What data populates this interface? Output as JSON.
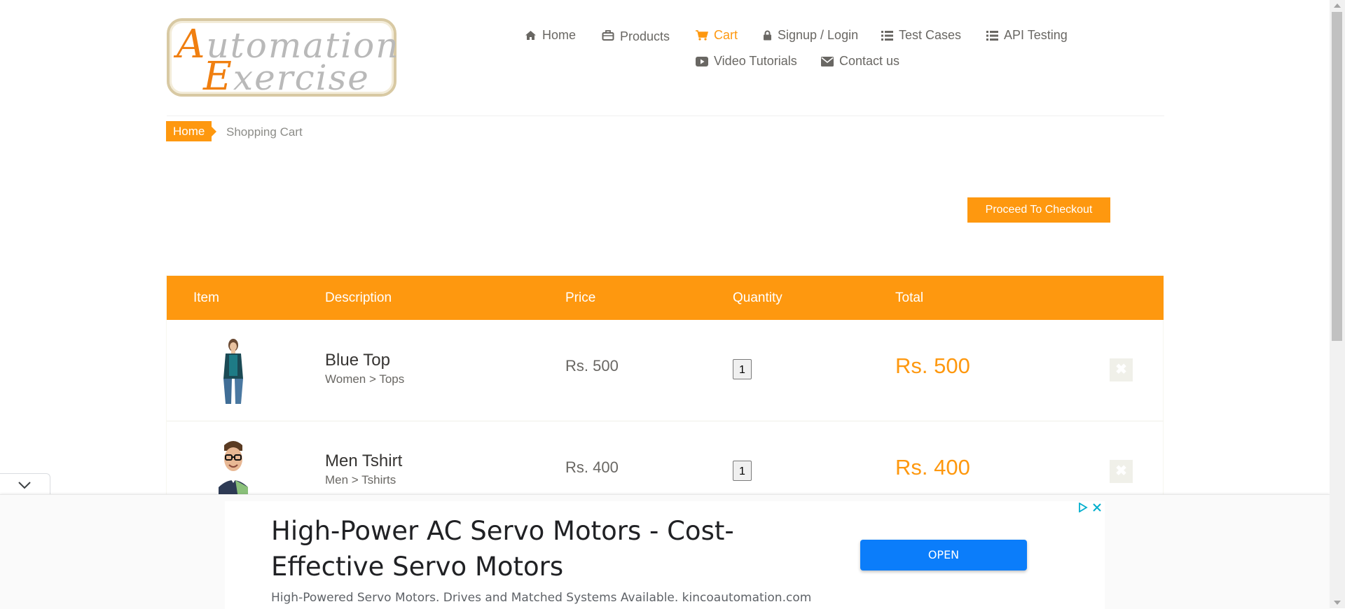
{
  "logo": {
    "line1_cap": "A",
    "line1_rest": "utomation",
    "line2_cap": "E",
    "line2_rest": "xercise"
  },
  "nav": {
    "items": [
      {
        "label": "Home",
        "icon": "home-icon"
      },
      {
        "label": "Products",
        "icon": "briefcase-icon"
      },
      {
        "label": "Cart",
        "icon": "cart-icon",
        "active": true
      },
      {
        "label": "Signup / Login",
        "icon": "lock-icon"
      },
      {
        "label": "Test Cases",
        "icon": "list-icon"
      },
      {
        "label": "API Testing",
        "icon": "list-icon"
      },
      {
        "label": "Video Tutorials",
        "icon": "youtube-play-icon"
      },
      {
        "label": "Contact us",
        "icon": "envelope-icon"
      }
    ]
  },
  "breadcrumb": {
    "home": "Home",
    "current": "Shopping Cart"
  },
  "checkout_label": "Proceed To Checkout",
  "cart": {
    "headers": {
      "item": "Item",
      "description": "Description",
      "price": "Price",
      "quantity": "Quantity",
      "total": "Total"
    },
    "rows": [
      {
        "name": "Blue Top",
        "category": "Women > Tops",
        "price": "Rs. 500",
        "quantity": "1",
        "total": "Rs. 500"
      },
      {
        "name": "Men Tshirt",
        "category": "Men > Tshirts",
        "price": "Rs. 400",
        "quantity": "1",
        "total": "Rs. 400"
      }
    ],
    "delete_glyph": "✖"
  },
  "ad": {
    "title": "High-Power AC Servo Motors - Cost-Effective Servo Motors",
    "description": "High-Powered Servo Motors. Drives and Matched Systems Available. kincoautomation.com",
    "open_label": "OPEN"
  },
  "colors": {
    "accent": "#fe980f",
    "ad_button": "#0b7dfa"
  }
}
